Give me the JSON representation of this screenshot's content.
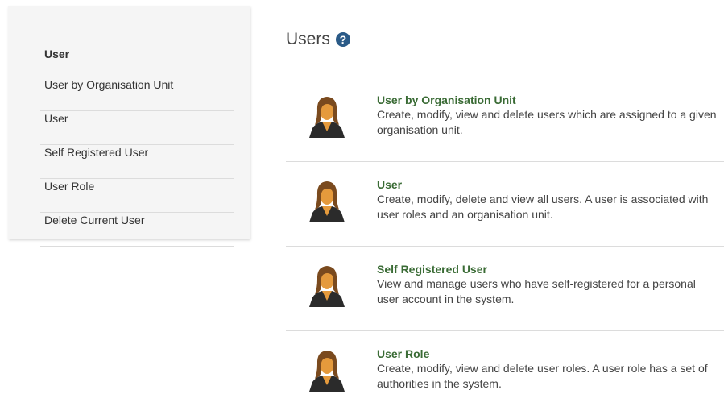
{
  "sidebar": {
    "header": "User",
    "items": [
      {
        "label": "User by Organisation Unit"
      },
      {
        "label": "User"
      },
      {
        "label": "Self Registered User"
      },
      {
        "label": "User Role"
      },
      {
        "label": "Delete Current User"
      }
    ]
  },
  "main": {
    "title": "Users",
    "help_icon": "question-circle",
    "items": [
      {
        "title": "User by Organisation Unit",
        "description": "Create, modify, view and delete users which are assigned to a given organisation unit.",
        "icon": "user-avatar"
      },
      {
        "title": "User",
        "description": "Create, modify, delete and view all users. A user is associated with user roles and an organisation unit.",
        "icon": "user-avatar"
      },
      {
        "title": "Self Registered User",
        "description": "View and manage users who have self-registered for a personal user account in the system.",
        "icon": "user-avatar"
      },
      {
        "title": "User Role",
        "description": "Create, modify, view and delete user roles. A user role has a set of authorities in the system.",
        "icon": "user-avatar"
      }
    ]
  },
  "colors": {
    "sidebar_bg": "#f5f5f5",
    "title_green": "#3a6b35",
    "help_icon_blue": "#2a5a87",
    "divider": "#dcdcdc"
  }
}
